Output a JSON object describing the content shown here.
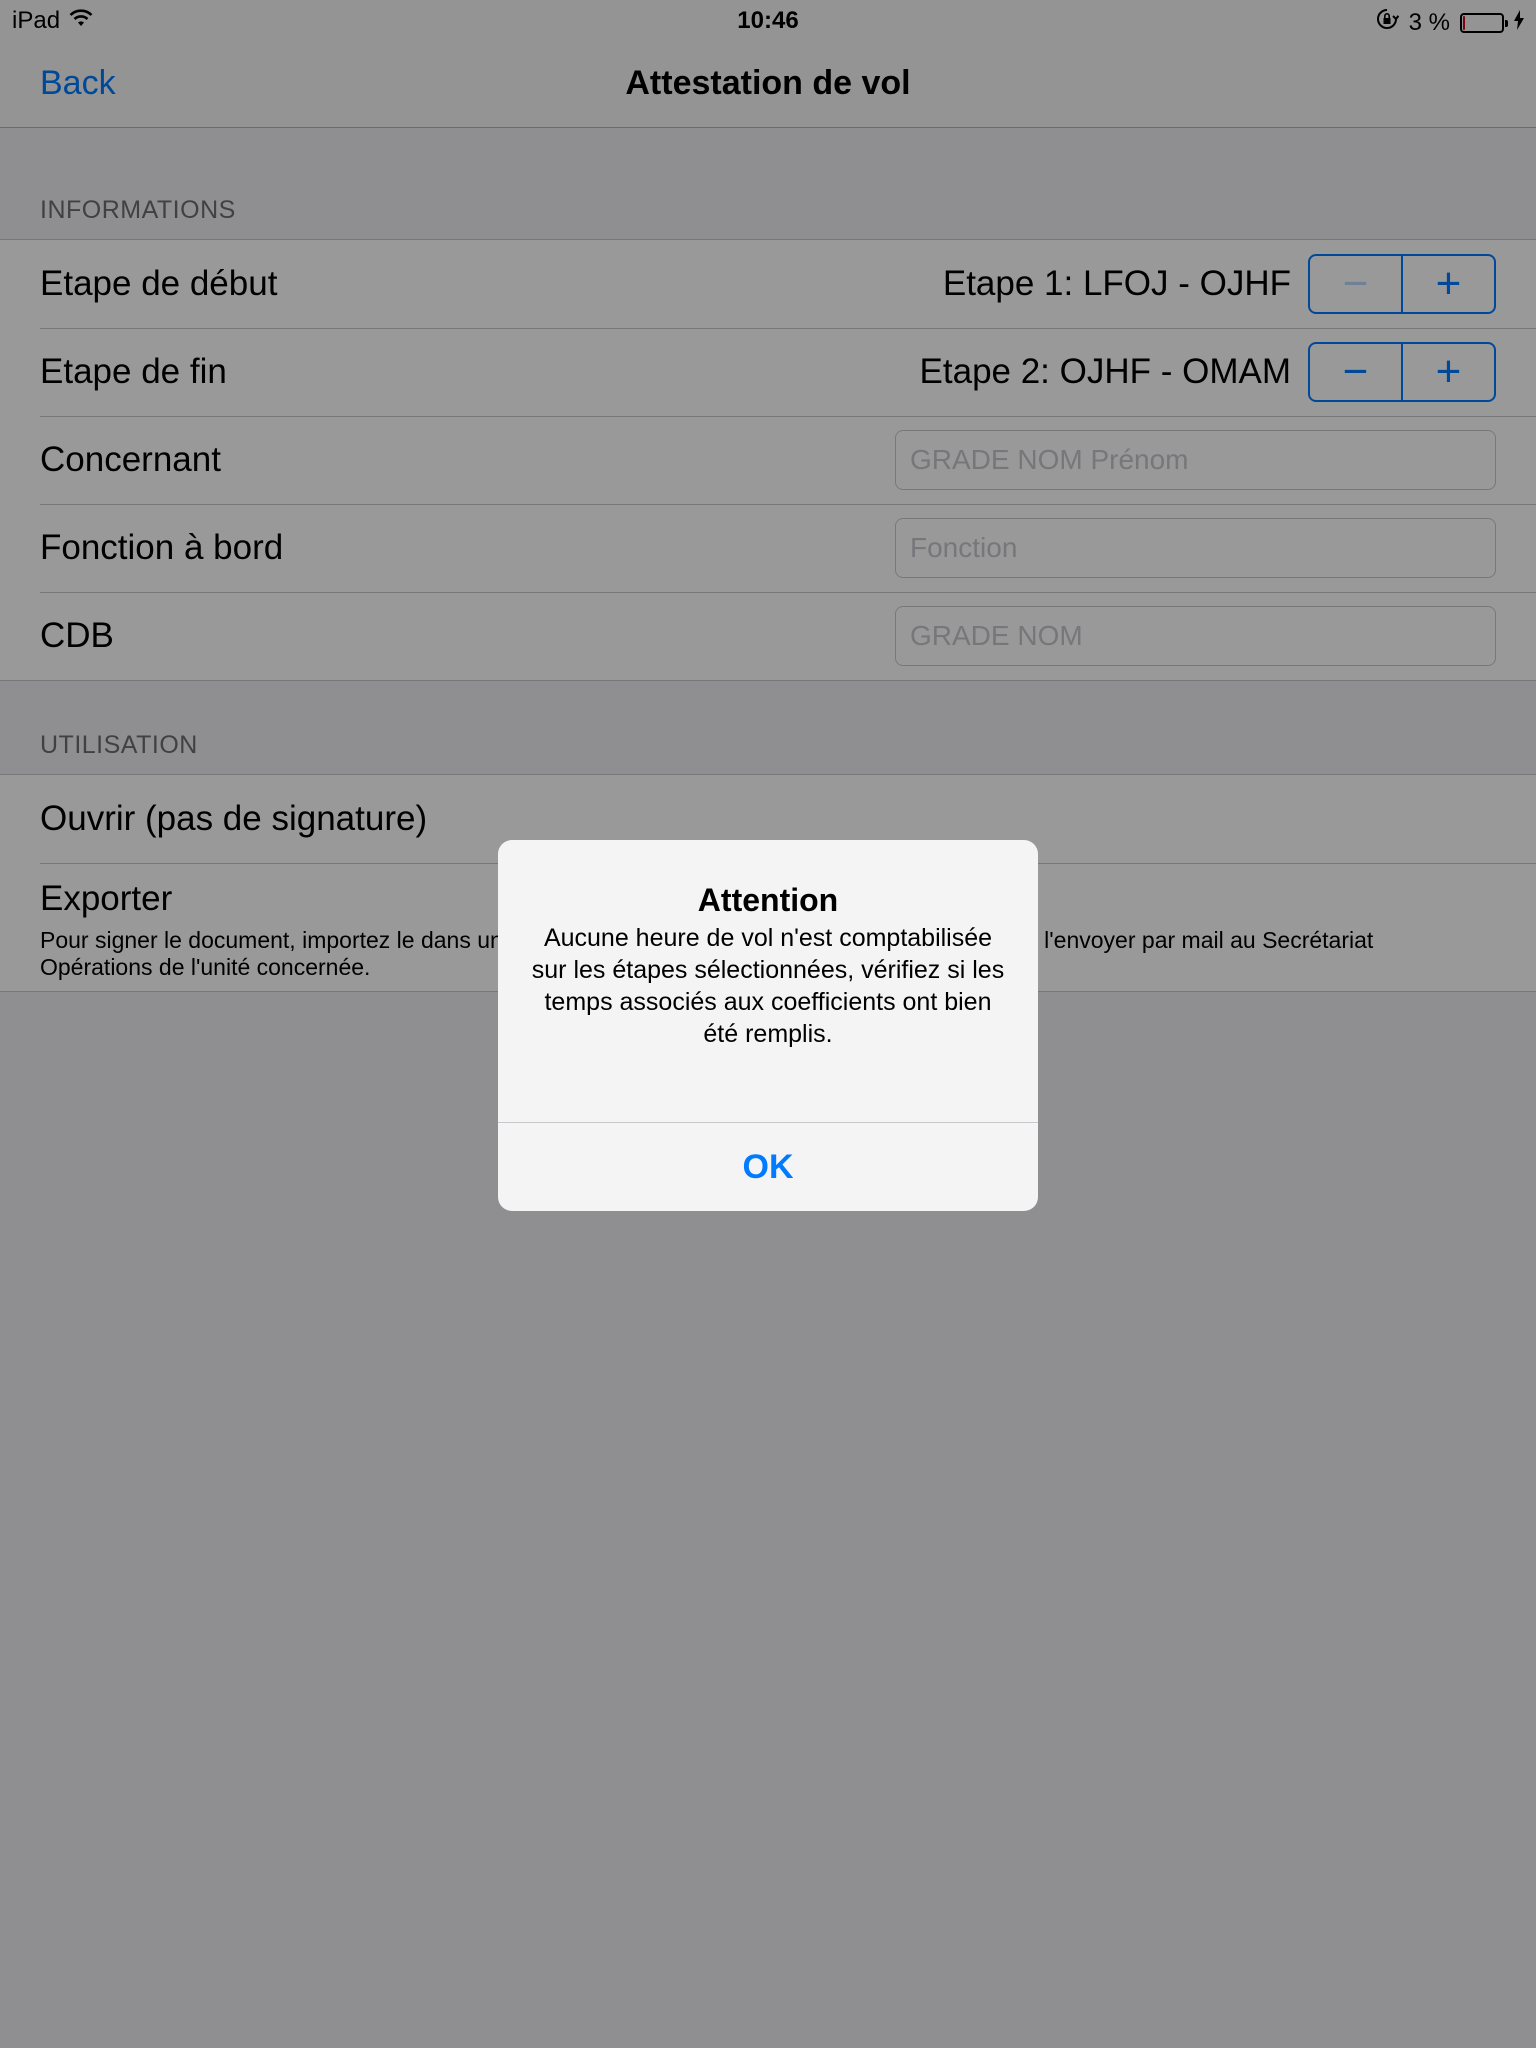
{
  "status_bar": {
    "device": "iPad",
    "time": "10:46",
    "battery_percent": "3 %",
    "battery_level": 0.03
  },
  "nav": {
    "back_label": "Back",
    "title": "Attestation de vol"
  },
  "informations": {
    "header": "INFORMATIONS",
    "etape_debut": {
      "label": "Etape de début",
      "value": "Etape 1: LFOJ - OJHF",
      "minus": "−",
      "plus": "+"
    },
    "etape_fin": {
      "label": "Etape de fin",
      "value": "Etape 2: OJHF - OMAM",
      "minus": "−",
      "plus": "+"
    },
    "concernant": {
      "label": "Concernant",
      "placeholder": "GRADE NOM Prénom"
    },
    "fonction": {
      "label": "Fonction à bord",
      "placeholder": "Fonction"
    },
    "cdb": {
      "label": "CDB",
      "placeholder": "GRADE NOM"
    }
  },
  "utilisation": {
    "header": "UTILISATION",
    "ouvrir_label": "Ouvrir (pas de signature)",
    "exporter_label": "Exporter",
    "exporter_desc": "Pour signer le document, importez le dans une application qui le permet. Il ne vous reste plus qu'à l'envoyer par mail au Secrétariat Opérations de l'unité concernée."
  },
  "alert": {
    "title": "Attention",
    "message": "Aucune heure de vol n'est comptabilisée sur les étapes sélectionnées, vérifiez si les temps associés aux coefficients ont bien été remplis.",
    "ok_label": "OK"
  }
}
